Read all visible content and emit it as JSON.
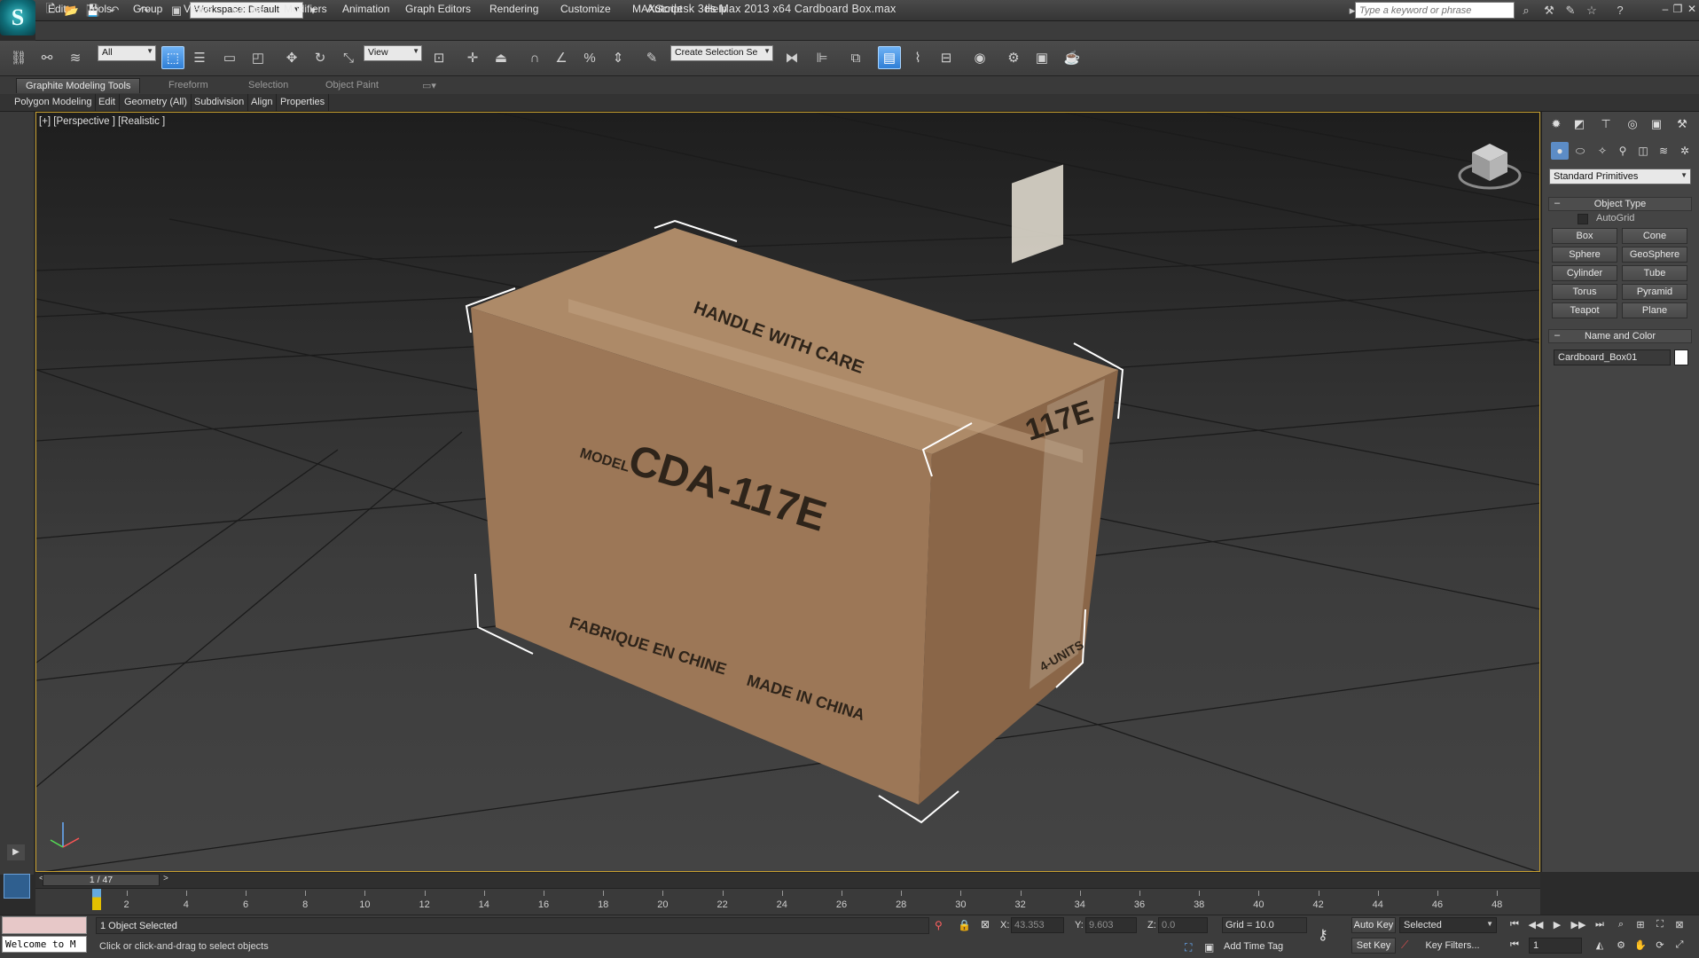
{
  "window": {
    "title": "Autodesk 3ds Max  2013 x64     Cardboard Box.max",
    "workspace": "Workspace: Default",
    "help_search_placeholder": "Type a keyword or phrase",
    "controls": {
      "minimize": "–",
      "restore": "❐",
      "close": "✕"
    }
  },
  "menu": {
    "items": [
      "Edit",
      "Tools",
      "Group",
      "Views",
      "Create",
      "Modifiers",
      "Animation",
      "Graph Editors",
      "Rendering",
      "Customize",
      "MAXScript",
      "Help"
    ]
  },
  "toolbar": {
    "selection_filter": "All",
    "ref_coord": "View",
    "named_selection": "Create Selection Se",
    "accent": "#3b8ee8"
  },
  "ribbon": {
    "tabs": [
      "Graphite Modeling Tools",
      "Freeform",
      "Selection",
      "Object Paint"
    ],
    "active_tab": "Graphite Modeling Tools",
    "panels": [
      "Polygon Modeling",
      "Edit",
      "Geometry (All)",
      "Subdivision",
      "Align",
      "Properties"
    ]
  },
  "viewport": {
    "label": "[+] [Perspective ] [Realistic ]",
    "border_color": "#c8a030",
    "box_texts": {
      "top": "HANDLE   WITH   CARE",
      "model_prefix": "MODEL",
      "model": "CDA-117E",
      "fabrique": "FABRIQUE EN CHINE",
      "made_in": "MADE IN CHINA",
      "side_code": "117E",
      "units": "4-UNITS"
    }
  },
  "command_panel": {
    "category": "Standard Primitives",
    "object_type_title": "Object Type",
    "autogrid_label": "AutoGrid",
    "primitives": [
      "Box",
      "Cone",
      "Sphere",
      "GeoSphere",
      "Cylinder",
      "Tube",
      "Torus",
      "Pyramid",
      "Teapot",
      "Plane"
    ],
    "name_color_title": "Name and Color",
    "object_name": "Cardboard_Box01",
    "object_color": "#ffffff"
  },
  "timeline": {
    "frame_display": "1 / 47",
    "prev": "<",
    "next": ">",
    "ticks": [
      2,
      4,
      6,
      8,
      10,
      12,
      14,
      16,
      18,
      20,
      22,
      24,
      26,
      28,
      30,
      32,
      34,
      36,
      38,
      40,
      42,
      44,
      46,
      48
    ]
  },
  "status": {
    "welcome": "Welcome to M",
    "selection": "1 Object Selected",
    "prompt": "Click or click-and-drag to select objects",
    "x_label": "X:",
    "x_value": "43.353",
    "y_label": "Y:",
    "y_value": "9.603",
    "z_label": "Z:",
    "z_value": "0.0",
    "grid": "Grid = 10.0",
    "add_time_tag": "Add Time Tag",
    "auto_key": "Auto Key",
    "set_key": "Set Key",
    "selected_dd": "Selected",
    "key_filters": "Key Filters...",
    "frame": "1"
  }
}
